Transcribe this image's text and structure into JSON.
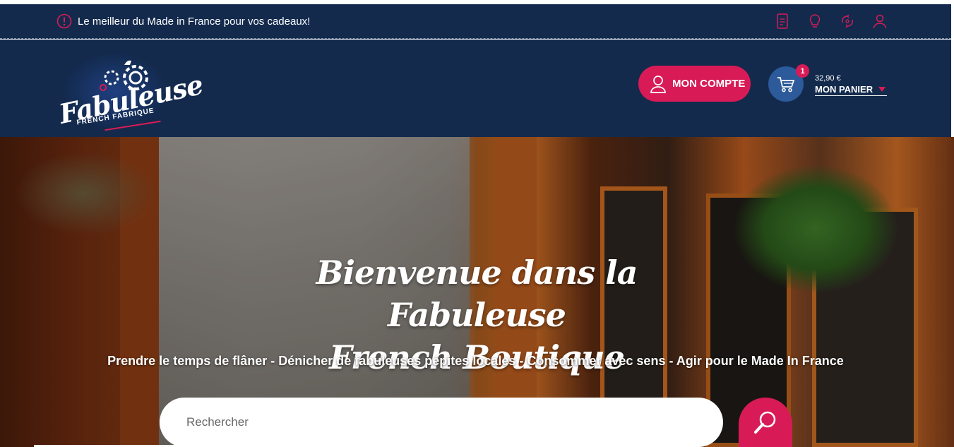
{
  "topbar": {
    "announcement": "Le meilleur du Made in France pour vos cadeaux!",
    "icons": [
      "alert-icon",
      "document-icon",
      "lightbulb-icon",
      "recycle-icon",
      "user-icon"
    ]
  },
  "header": {
    "logo": {
      "wordmark": "Fabuleuse",
      "tagline": "FRENCH FABRIQUE"
    },
    "account_button": "MON COMPTE",
    "cart": {
      "count": "1",
      "price": "32,90 €",
      "label": "MON PANIER"
    }
  },
  "hero": {
    "title_line1": "Bienvenue dans la Fabuleuse",
    "title_line2": "French Boutique",
    "subtitle": "Prendre le temps de flâner - Dénicher de fabuleuses pépites locales - Consommer avec sens - Agir pour le Made In France",
    "search_placeholder": "Rechercher"
  },
  "colors": {
    "navy": "#132a4d",
    "accent": "#d81b56",
    "cart_blue": "#2c5a9a"
  }
}
